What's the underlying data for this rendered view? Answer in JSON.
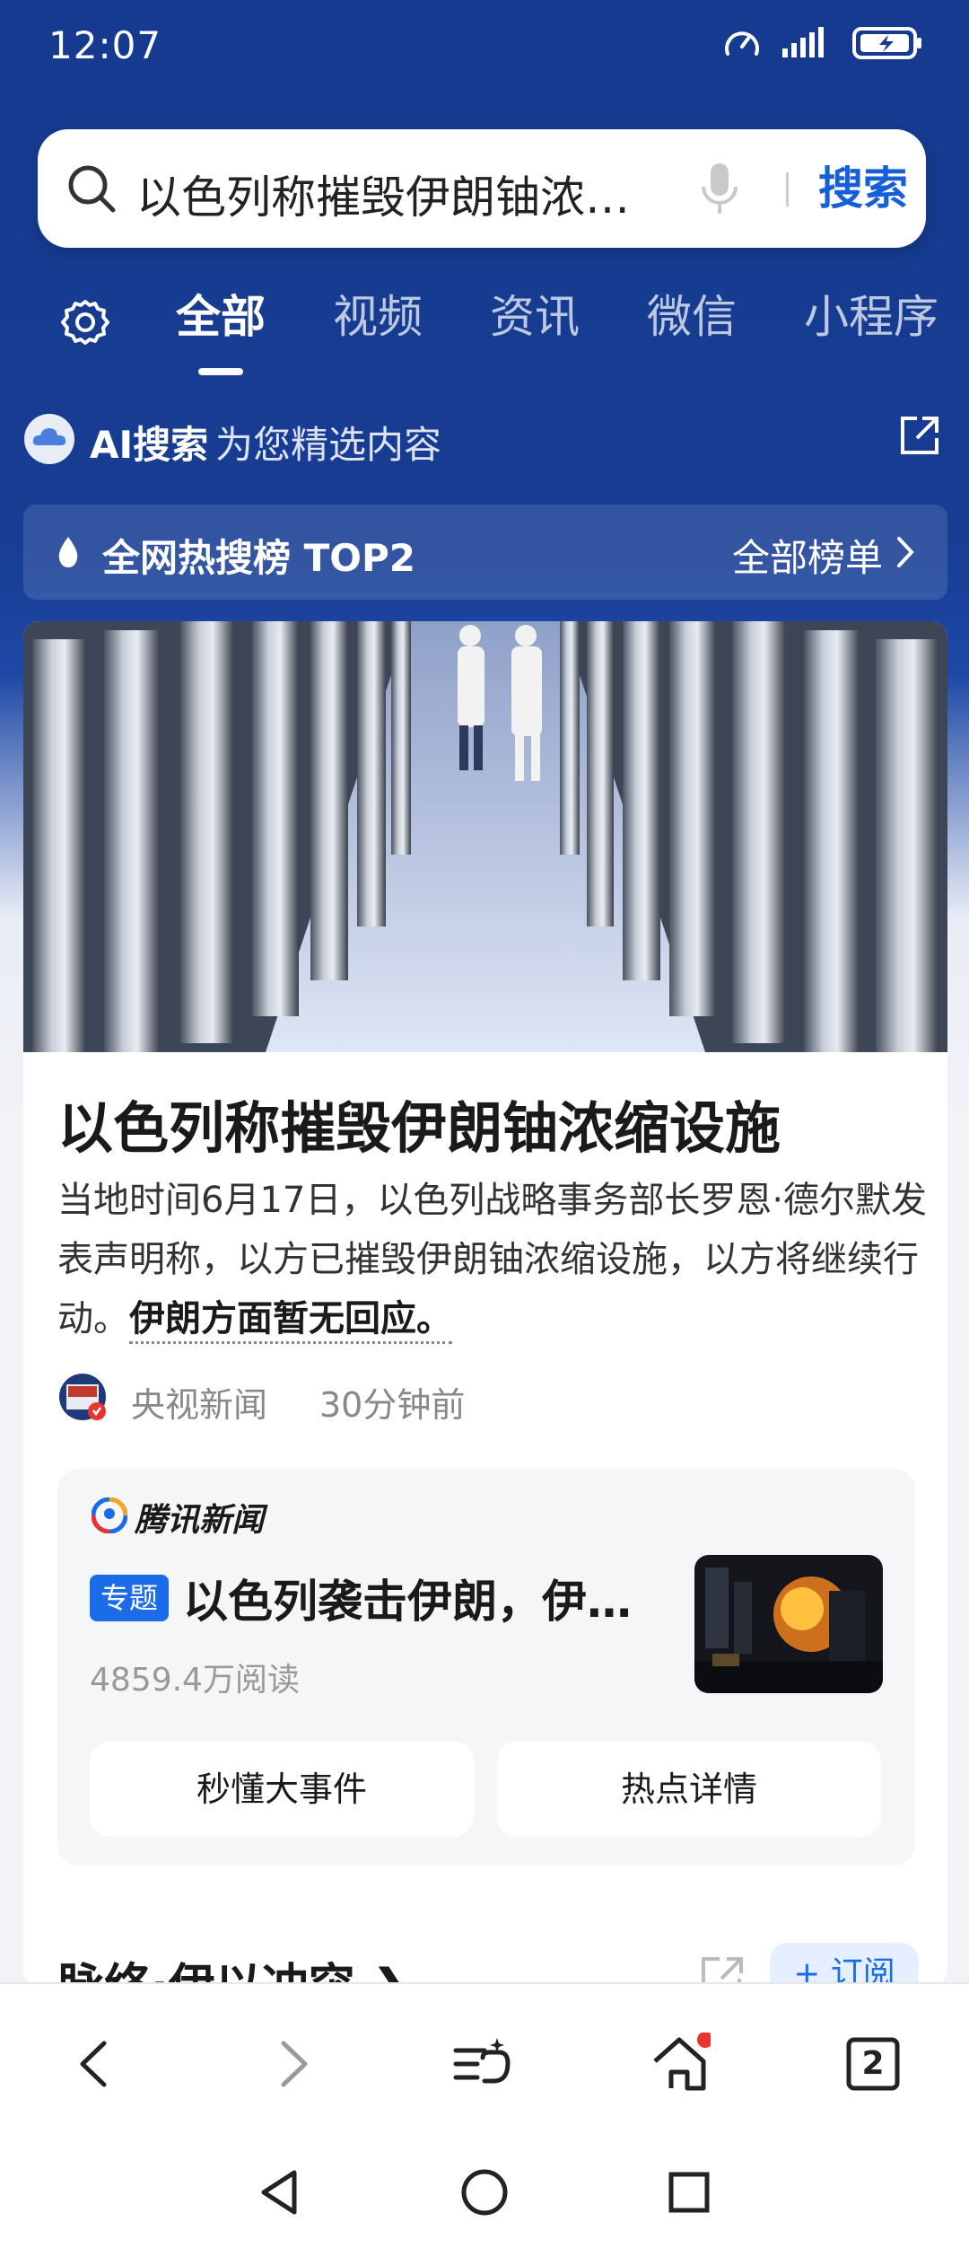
{
  "status_bar": {
    "time": "12:07"
  },
  "search": {
    "query": "以色列称摧毁伊朗铀浓…",
    "button_label": "搜索"
  },
  "tabs": [
    {
      "label": "全部",
      "active": true
    },
    {
      "label": "视频",
      "active": false
    },
    {
      "label": "资讯",
      "active": false
    },
    {
      "label": "微信",
      "active": false
    },
    {
      "label": "小程序",
      "active": false
    }
  ],
  "ai_search": {
    "title": "AI搜索",
    "subtitle": "为您精选内容"
  },
  "hot_bar": {
    "label": "全网热搜榜 TOP2",
    "all_label": "全部榜单"
  },
  "article": {
    "headline": "以色列称摧毁伊朗铀浓缩设施",
    "summary": "当地时间6月17日，以色列战略事务部长罗恩·德尔默发表声明称，以方已摧毁伊朗铀浓缩设施，以方将继续行动。",
    "summary_bold": "伊朗方面暂无回应。",
    "source": "央视新闻",
    "time": "30分钟前",
    "avatar_text": "央视新闻"
  },
  "topic": {
    "provider": "腾讯新闻",
    "badge": "专题",
    "title": "以色列袭击伊朗，伊朗…",
    "reads": "4859.4万阅读",
    "buttons": [
      "秒懂大事件",
      "热点详情"
    ]
  },
  "next_section": {
    "title": "脉络·伊以冲突",
    "subscribe_label": "订阅"
  },
  "browser_bar": {
    "tab_count": "2"
  },
  "colors": {
    "header_blue": "#163a8f",
    "accent_blue": "#1c6be8",
    "search_blue": "#1560d8",
    "badge_red": "#e8332f"
  },
  "icons": [
    "search-icon",
    "mic-icon",
    "gear-icon",
    "ai-cloud-icon",
    "external-link-icon",
    "flame-icon",
    "chevron-right-icon",
    "back-icon",
    "forward-icon",
    "menu-icon",
    "home-icon",
    "tabs-icon"
  ]
}
